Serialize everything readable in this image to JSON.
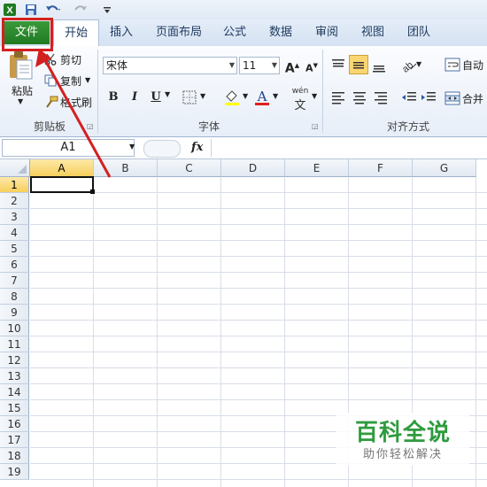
{
  "qat": {
    "app_icon": "excel-icon",
    "save_icon": "save-icon",
    "undo_icon": "undo-icon",
    "redo_icon": "redo-icon",
    "customize_icon": "customize-qat-icon"
  },
  "tabs": [
    {
      "label": "文件",
      "name": "tab-file"
    },
    {
      "label": "开始",
      "name": "tab-home"
    },
    {
      "label": "插入",
      "name": "tab-insert"
    },
    {
      "label": "页面布局",
      "name": "tab-page-layout"
    },
    {
      "label": "公式",
      "name": "tab-formulas"
    },
    {
      "label": "数据",
      "name": "tab-data"
    },
    {
      "label": "审阅",
      "name": "tab-review"
    },
    {
      "label": "视图",
      "name": "tab-view"
    },
    {
      "label": "团队",
      "name": "tab-team"
    }
  ],
  "clipboard": {
    "paste": "粘贴",
    "cut": "剪切",
    "copy": "复制",
    "format_painter": "格式刷",
    "group": "剪贴板"
  },
  "font": {
    "name": "宋体",
    "size": "11",
    "group": "字体",
    "bold": "B",
    "italic": "I",
    "underline": "U",
    "wen": "wén"
  },
  "alignment": {
    "wrap": "自动",
    "merge": "合并",
    "group": "对齐方式"
  },
  "formula_bar": {
    "name_box": "A1",
    "fx": "fx",
    "value": ""
  },
  "columns": [
    "A",
    "B",
    "C",
    "D",
    "E",
    "F",
    "G"
  ],
  "rows": [
    "1",
    "2",
    "3",
    "4",
    "5",
    "6",
    "7",
    "8",
    "9",
    "10",
    "11",
    "12",
    "13",
    "14",
    "15",
    "16",
    "17",
    "18",
    "19"
  ],
  "selected": {
    "cell": "A1",
    "column": "A",
    "row": "1"
  },
  "watermark": {
    "title": "百科全说",
    "subtitle": "助你轻松解决"
  },
  "colors": {
    "file_tab": "#1f7a22",
    "highlight": "#d42020",
    "watermark_green": "#2e9b3e",
    "selected_header": "#f7cf5c"
  }
}
